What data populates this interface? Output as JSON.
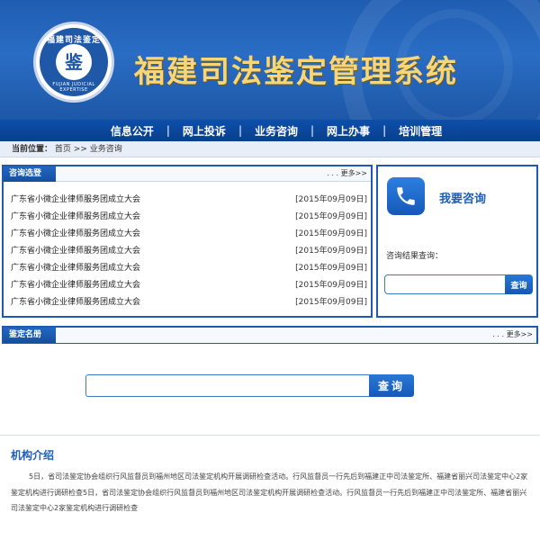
{
  "header": {
    "site_title": "福建司法鉴定管理系统",
    "logo": {
      "ring_text": "福建司法鉴定",
      "bottom_text": "FUJIAN JUDICIAL EXPERTISE",
      "center_glyph": "鉴"
    }
  },
  "nav": {
    "items": [
      "信息公开",
      "网上投诉",
      "业务咨询",
      "网上办事",
      "培训管理"
    ],
    "separator": "|"
  },
  "breadcrumb": {
    "label": "当前位置：",
    "home": "首页",
    "sep": ">>",
    "current": "业务咨询"
  },
  "consult_select": {
    "title": "咨询选登",
    "more": ". . . 更多>>",
    "items": [
      {
        "title": "广东省小微企业律师服务团成立大会",
        "date": "[2015年09月09日]"
      },
      {
        "title": "广东省小微企业律师服务团成立大会",
        "date": "[2015年09月09日]"
      },
      {
        "title": "广东省小微企业律师服务团成立大会",
        "date": "[2015年09月09日]"
      },
      {
        "title": "广东省小微企业律师服务团成立大会",
        "date": "[2015年09月09日]"
      },
      {
        "title": "广东省小微企业律师服务团成立大会",
        "date": "[2015年09月09日]"
      },
      {
        "title": "广东省小微企业律师服务团成立大会",
        "date": "[2015年09月09日]"
      },
      {
        "title": "广东省小微企业律师服务团成立大会",
        "date": "[2015年09月09日]"
      }
    ]
  },
  "consult_box": {
    "title": "我要咨询",
    "query_label": "咨询结果查询：",
    "input_placeholder": "",
    "button": "查询",
    "icon": "phone-icon"
  },
  "roster": {
    "title": "鉴定名册",
    "more": ". . . 更多>>"
  },
  "search": {
    "placeholder": "",
    "button": "查询"
  },
  "intro": {
    "title": "机构介绍",
    "text": "5日，省司法鉴定协会组织行风监督员到福州地区司法鉴定机构开展调研检查活动。行风监督员一行先后到福建正中司法鉴定所、福建省丽兴司法鉴定中心2家鉴定机构进行调研检查5日，省司法鉴定协会组织行风监督员到福州地区司法鉴定机构开展调研检查活动。行风监督员一行先后到福建正中司法鉴定所、福建省丽兴司法鉴定中心2家鉴定机构进行调研检查"
  },
  "colors": {
    "primary": "#1f5ab0",
    "title_gold": "#f6d67a",
    "accent_text": "#1d5fb6"
  }
}
